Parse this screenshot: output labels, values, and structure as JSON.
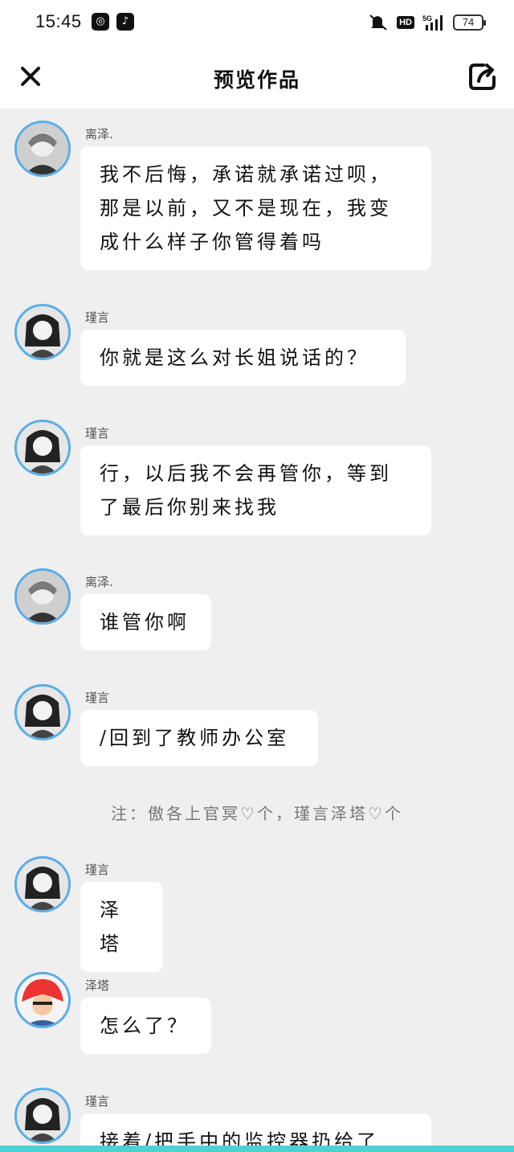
{
  "status_bar": {
    "time": "15:45",
    "app_icons": [
      "kuaishou-app-icon",
      "tiktok-app-icon"
    ],
    "hd": "HD",
    "network": "5G",
    "battery": "74"
  },
  "header": {
    "title": "预览作品",
    "close_icon": "close-icon",
    "share_icon": "share-icon"
  },
  "colors": {
    "avatar_ring": "#58aee8",
    "background": "#efefef",
    "bubble": "#ffffff",
    "bottom_strip": "#4cd1d5"
  },
  "messages": [
    {
      "speaker": "离泽.",
      "text": "我不后悔，承诺就承诺过呗，那是以前，又不是现在，我变成什么样子你管得着吗"
    },
    {
      "speaker": "瑾言",
      "text": "你就是这么对长姐说话的？"
    },
    {
      "speaker": "瑾言",
      "text": "行，以后我不会再管你，等到了最后你别来找我"
    },
    {
      "speaker": "离泽.",
      "text": "谁管你啊"
    },
    {
      "speaker": "瑾言",
      "text": "/回到了教师办公室"
    },
    {
      "note": "注：傲各上官冥♡个，瑾言泽塔♡个"
    },
    {
      "speaker": "瑾言",
      "text": "泽塔"
    },
    {
      "speaker": "泽塔",
      "text": "怎么了？"
    },
    {
      "speaker": "瑾言",
      "text": "接着/把手中的监控器扔给了"
    }
  ]
}
